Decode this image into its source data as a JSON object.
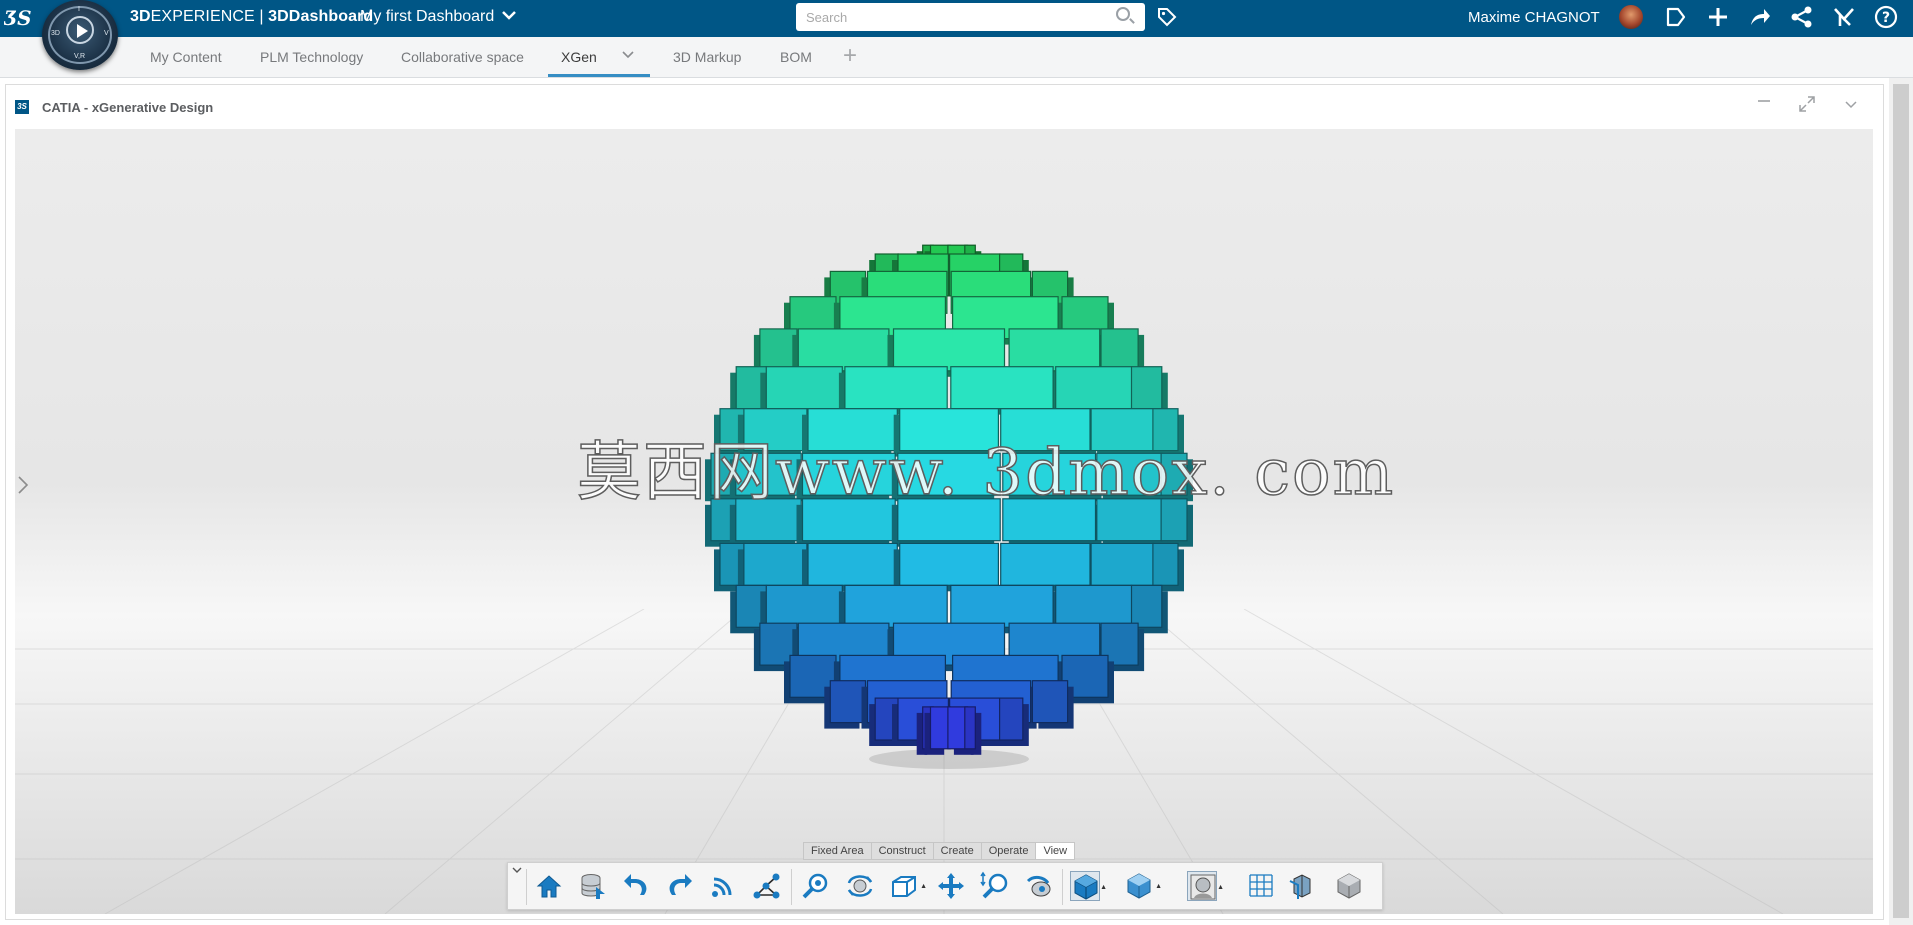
{
  "topbar": {
    "brand_light": "3D",
    "brand_mid": "EXPERIENCE | ",
    "brand_bold": "3DDashboard",
    "dashboard_title": "My first Dashboard",
    "search_placeholder": "Search",
    "user_name": "Maxime CHAGNOT",
    "compass_labels": {
      "top": "I",
      "left": "3D",
      "right": "V",
      "bottom": "V,R"
    },
    "icons": [
      "tag-icon",
      "chat-icon",
      "add-icon",
      "share-icon",
      "social-icon",
      "apps-icon",
      "help-icon"
    ]
  },
  "tabs": [
    {
      "label": "My Content"
    },
    {
      "label": "PLM Technology"
    },
    {
      "label": "Collaborative space"
    },
    {
      "label": "XGen",
      "active": true
    },
    {
      "label": "3D Markup"
    },
    {
      "label": "BOM"
    }
  ],
  "widget": {
    "title": "CATIA - xGenerative Design",
    "app_icon_text": "3S"
  },
  "viewport": {
    "watermark": "莫西网www. 3dmox. com",
    "model": {
      "type": "voxel-sphere",
      "gradient_colors": [
        "#22c84a",
        "#2de88a",
        "#26d9d0",
        "#1fb0d8",
        "#1f6fd0",
        "#3434e8"
      ]
    }
  },
  "action_bar": {
    "tabs": [
      {
        "label": "Fixed Area"
      },
      {
        "label": "Construct"
      },
      {
        "label": "Create"
      },
      {
        "label": "Operate"
      },
      {
        "label": "View",
        "active": true
      }
    ],
    "tools": [
      "home-icon",
      "database-icon",
      "undo-icon",
      "redo-icon",
      "signal-icon",
      "network-icon",
      "zoom-search-icon",
      "rotate-icon",
      "box-view-icon",
      "pan-icon",
      "zoom-icon",
      "fly-icon",
      "shaded-view-icon",
      "cube-icon",
      "render-icon",
      "grid-icon",
      "section-icon",
      "solid-cube-icon"
    ]
  },
  "colors": {
    "topbar": "#005686",
    "tab_accent": "#368ec4",
    "tool_blue": "#1a7bc1"
  }
}
